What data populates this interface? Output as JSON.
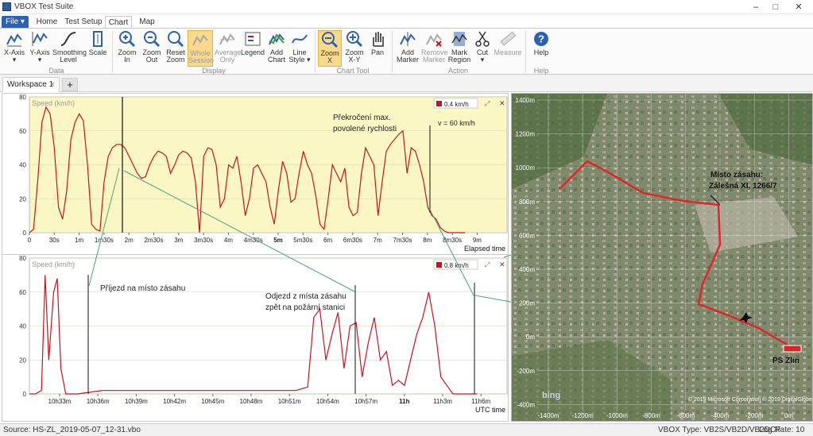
{
  "window": {
    "title": "VBOX Test Suite"
  },
  "ribbon_tabs": {
    "file": "File ▾",
    "home": "Home",
    "test_setup": "Test Setup",
    "chart": "Chart",
    "map": "Map"
  },
  "ribbon": {
    "x_axis": "X-Axis",
    "y_axis": "Y-Axis",
    "smoothing_1": "Smoothing",
    "smoothing_2": "Level",
    "scale": "Scale",
    "zoom_in_1": "Zoom",
    "zoom_in_2": "In",
    "zoom_out_1": "Zoom",
    "zoom_out_2": "Out",
    "reset_zoom_1": "Reset",
    "reset_zoom_2": "Zoom",
    "whole_session_1": "Whole",
    "whole_session_2": "Session",
    "average_only_1": "Average",
    "average_only_2": "Only",
    "legend": "Legend",
    "add_chart_1": "Add",
    "add_chart_2": "Chart",
    "line_style_1": "Line",
    "line_style_2": "Style ▾",
    "zoom_x_1": "Zoom",
    "zoom_x_2": "X",
    "zoom_xy_1": "Zoom",
    "zoom_xy_2": "X-Y",
    "pan": "Pan",
    "add_marker_1": "Add",
    "add_marker_2": "Marker",
    "remove_marker_1": "Remove",
    "remove_marker_2": "Marker",
    "mark_region_1": "Mark",
    "mark_region_2": "Region",
    "cut": "Cut",
    "measure": "Measure",
    "help": "Help",
    "group_data": "Data",
    "group_display": "Display",
    "group_chart_tool": "Chart Tool",
    "group_action": "Action",
    "group_help": "Help"
  },
  "workspace": {
    "tab_label": "Workspace 1",
    "close": "×",
    "add": "+"
  },
  "chart_data": [
    {
      "type": "line",
      "ylabel": "Speed (km/h)",
      "xlabel": "Elapsed time",
      "ylim": [
        0,
        80
      ],
      "yticks": [
        "0",
        "20",
        "40",
        "60",
        "80"
      ],
      "xticks": [
        "0",
        "30s",
        "1m",
        "1m30s",
        "2m",
        "2m30s",
        "3m",
        "3m30s",
        "4m",
        "4m30s",
        "5m",
        "5m30s",
        "6m",
        "6m30s",
        "7m",
        "7m30s",
        "8m",
        "8m30s",
        "9m"
      ],
      "legend": "0.4 km/h",
      "series_color": "#c8141e",
      "background": "#fbf7c5",
      "annotations": {
        "overspeed_1": "Překročení max.",
        "overspeed_2": "povolené rychlosti",
        "limit": "v = 60 km/h"
      },
      "x_seconds": [
        0,
        5,
        10,
        15,
        20,
        25,
        30,
        35,
        40,
        45,
        50,
        55,
        60,
        65,
        70,
        75,
        80,
        85,
        90,
        95,
        100,
        105,
        110,
        115,
        120,
        125,
        130,
        135,
        140,
        145,
        150,
        155,
        160,
        165,
        170,
        175,
        180,
        185,
        190,
        195,
        200,
        205,
        210,
        215,
        220,
        225,
        230,
        235,
        240,
        245,
        250,
        255,
        260,
        265,
        270,
        275,
        280,
        285,
        290,
        295,
        300,
        305,
        310,
        315,
        320,
        325,
        330,
        335,
        340,
        345,
        350,
        355,
        360,
        365,
        370,
        375,
        380,
        385,
        390,
        395,
        400,
        405,
        410,
        415,
        420,
        425,
        430,
        435,
        440,
        445,
        450,
        455,
        460,
        465,
        470,
        475,
        480,
        485,
        490,
        495,
        500,
        505,
        510,
        515,
        520,
        525
      ],
      "y_speed": [
        0,
        2,
        30,
        65,
        74,
        70,
        50,
        15,
        8,
        25,
        55,
        65,
        70,
        66,
        40,
        5,
        2,
        1,
        30,
        45,
        50,
        52,
        52,
        50,
        45,
        40,
        35,
        32,
        33,
        40,
        45,
        48,
        47,
        45,
        35,
        40,
        46,
        48,
        47,
        44,
        30,
        0,
        45,
        50,
        49,
        40,
        15,
        20,
        40,
        38,
        45,
        30,
        10,
        20,
        38,
        40,
        35,
        30,
        15,
        5,
        25,
        42,
        35,
        18,
        20,
        35,
        48,
        40,
        35,
        22,
        5,
        2,
        20,
        40,
        35,
        30,
        38,
        15,
        10,
        12,
        35,
        50,
        45,
        40,
        10,
        30,
        48,
        52,
        55,
        58,
        60,
        35,
        50,
        48,
        40,
        30,
        15,
        10,
        8,
        3,
        1,
        0,
        0,
        0,
        0,
        0
      ]
    },
    {
      "type": "line",
      "ylabel": "Speed (km/h)",
      "xlabel": "UTC time",
      "ylim": [
        0,
        80
      ],
      "yticks": [
        "0",
        "20",
        "40",
        "60",
        "80"
      ],
      "xticks": [
        "10h33m",
        "10h36m",
        "10h39m",
        "10h42m",
        "10h45m",
        "10h48m",
        "10h51m",
        "10h54m",
        "10h57m",
        "11h",
        "11h3m",
        "11h6m"
      ],
      "legend": "0.8 km/h",
      "series_color": "#c8141e",
      "background": "#ffffff",
      "annotations": {
        "arrival": "Příjezd na místo zásahu",
        "departure_1": "Odjezd z místa zásahu",
        "departure_2": "zpět na požární stanici"
      },
      "x_minutes": [
        0,
        0.5,
        1,
        1.3,
        1.6,
        2,
        2.3,
        2.6,
        3,
        3.5,
        4,
        5,
        6,
        7,
        8,
        10,
        12,
        15,
        18,
        20,
        22,
        23,
        23.5,
        24,
        24.5,
        25,
        25.5,
        26,
        26.5,
        27,
        27.5,
        28,
        28.5,
        29,
        29.5,
        30,
        30.5,
        31,
        31.5,
        32,
        32.5,
        33,
        33.5,
        34,
        34.5,
        35,
        35.5,
        36,
        36.5,
        37
      ],
      "y_speed": [
        0,
        0,
        2,
        70,
        20,
        60,
        68,
        15,
        0,
        0,
        0,
        1,
        2,
        2,
        2,
        2,
        2,
        2,
        2,
        2,
        2,
        4,
        45,
        50,
        20,
        35,
        48,
        15,
        40,
        42,
        10,
        30,
        45,
        20,
        25,
        5,
        8,
        5,
        20,
        35,
        45,
        60,
        40,
        10,
        5,
        0,
        0,
        0,
        0,
        0
      ]
    }
  ],
  "map": {
    "yticks": [
      "1400m",
      "1200m",
      "1000m",
      "800m",
      "600m",
      "400m",
      "200m",
      "0m",
      "-200m",
      "-400m"
    ],
    "xticks": [
      "-1400m",
      "-1200m",
      "-1000m",
      "-800m",
      "-600m",
      "-400m",
      "-200m",
      "0m"
    ],
    "label_site_1": "Místo zásahu:",
    "label_site_2": "Zálešná XI, 1266/7",
    "label_station": "PS Zlín",
    "brand": "bing",
    "copyright": "© 2019 Microsoft Corporation © 2019 DigitalGlobe"
  },
  "status": {
    "source": "Source: HS-ZL_2019-05-07_12-31.vbo",
    "vbox_type": "VBOX Type: VB2S/VB2D/VB2DCF",
    "log_rate": "Log Rate: 10"
  }
}
